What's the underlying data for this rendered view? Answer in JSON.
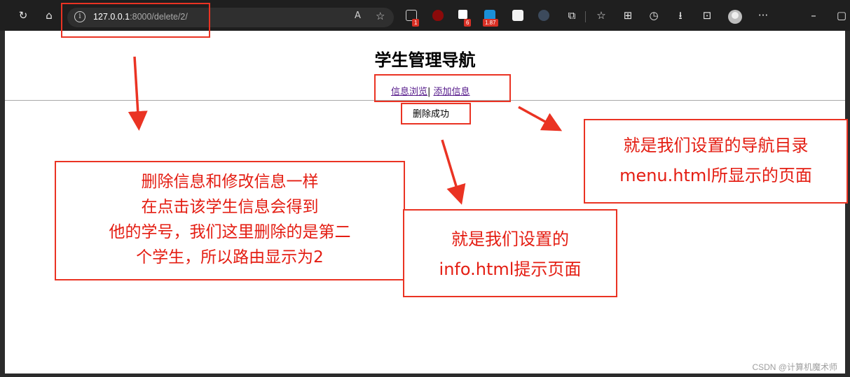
{
  "browser": {
    "address": {
      "host": "127.0.0.1",
      "path": ":8000/delete/2/"
    },
    "read_aloud_label": "A",
    "badges": {
      "ext1": "1",
      "ext3": "6",
      "ext4": "1.87"
    },
    "more_label": "···"
  },
  "page": {
    "title": "学生管理导航",
    "nav": {
      "link1": "信息浏览",
      "separator": "|",
      "link2": "添加信息"
    },
    "message": "删除成功"
  },
  "annotations": {
    "left": [
      "删除信息和修改信息一样",
      "在点击该学生信息会得到",
      "他的学号，我们这里删除的是第二",
      "个学生，所以路由显示为2"
    ],
    "middle": [
      "就是我们设置的",
      "info.html提示页面"
    ],
    "right": [
      "就是我们设置的导航目录",
      "menu.html所显示的页面"
    ],
    "accent_color": "#ea3323"
  },
  "watermark": "CSDN @计算机魔术师"
}
